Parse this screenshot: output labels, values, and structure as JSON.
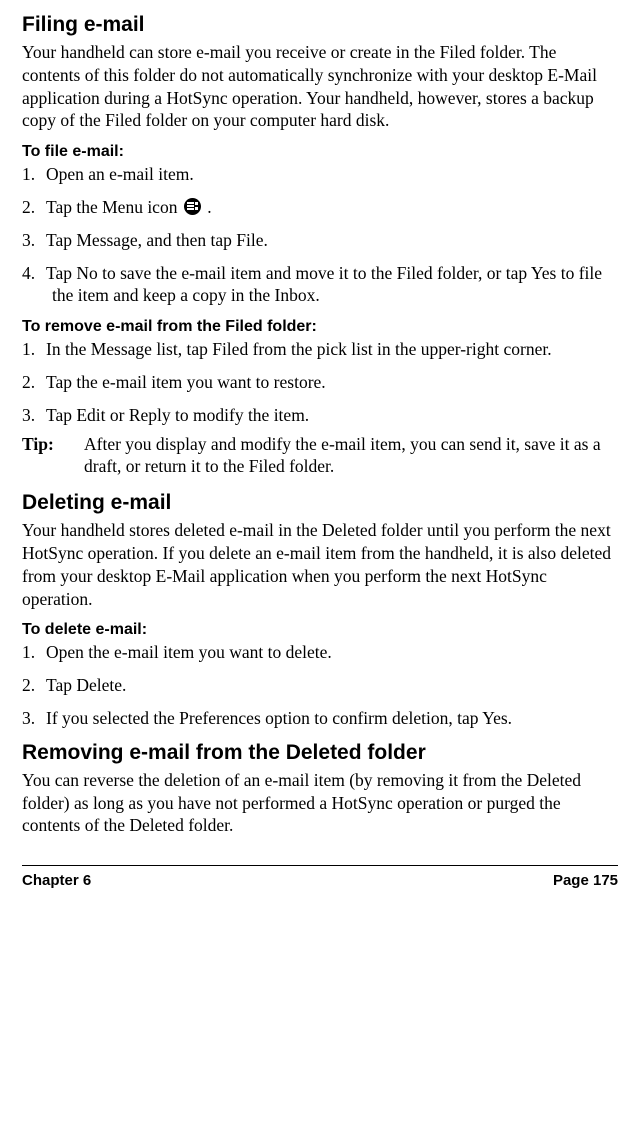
{
  "section1": {
    "title": "Filing e-mail",
    "intro": "Your handheld can store e-mail you receive or create in the Filed folder. The contents of this folder do not automatically synchronize with your desktop E-Mail application during a HotSync operation. Your handheld, however, stores a backup copy of the Filed folder on your computer hard disk.",
    "sub1": "To file e-mail:",
    "steps1": {
      "s1": "Open an e-mail item.",
      "s2a": "Tap the Menu icon ",
      "s2b": " .",
      "s3": "Tap Message, and then tap File.",
      "s4": "Tap No to save the e-mail item and move it to the Filed folder, or tap Yes to file the item and keep a copy in the Inbox."
    },
    "sub2": "To remove e-mail from the Filed folder:",
    "steps2": {
      "s1": "In the Message list, tap Filed from the pick list in the upper-right corner.",
      "s2": "Tap the e-mail item you want to restore.",
      "s3": "Tap Edit or Reply to modify the item."
    },
    "tip_label": "Tip:",
    "tip_text": "After you display and modify the e-mail item, you can send it, save it as a draft, or return it to the Filed folder."
  },
  "section2": {
    "title": "Deleting e-mail",
    "intro": "Your handheld stores deleted e-mail in the Deleted folder until you perform the next HotSync operation. If you delete an e-mail item from the handheld, it is also deleted from your desktop E-Mail application when you perform the next HotSync operation.",
    "sub1": "To delete e-mail:",
    "steps1": {
      "s1": "Open the e-mail item you want to delete.",
      "s2": "Tap Delete.",
      "s3": "If you selected the Preferences option to confirm deletion, tap Yes."
    }
  },
  "section3": {
    "title": "Removing e-mail from the Deleted folder",
    "intro": "You can reverse the deletion of an e-mail item (by removing it from the Deleted folder) as long as you have not performed a HotSync operation or purged the contents of the Deleted folder."
  },
  "footer": {
    "left": "Chapter 6",
    "right": "Page 175"
  }
}
